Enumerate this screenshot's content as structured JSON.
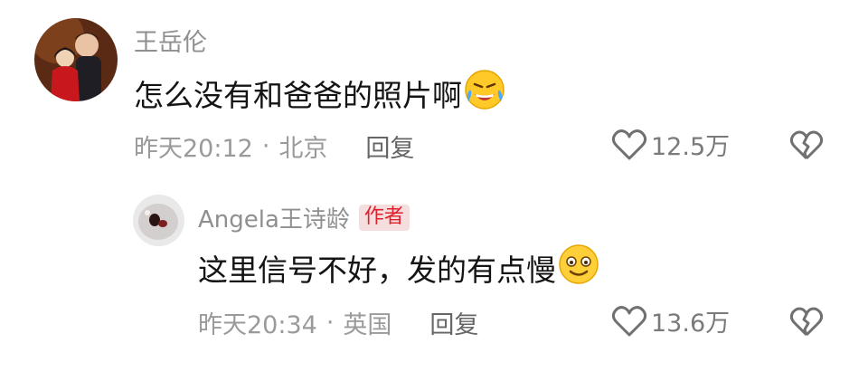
{
  "comments": [
    {
      "username": "王岳伦",
      "text": "怎么没有和爸爸的照片啊",
      "emoji": "laughing-with-tears-emoji",
      "time": "昨天20:12",
      "separator": "·",
      "location": "北京",
      "reply_label": "回复",
      "likes": "12.5万"
    },
    {
      "username": "Angela王诗龄",
      "author_badge": "作者",
      "text": "这里信号不好，发的有点慢",
      "emoji": "smiling-emoji",
      "time": "昨天20:34",
      "separator": "·",
      "location": "英国",
      "reply_label": "回复",
      "likes": "13.6万"
    }
  ],
  "colors": {
    "username": "#8f8f8f",
    "meta": "#9a9a9a",
    "author_badge_bg": "#f5dede",
    "author_badge_text": "#e0202c"
  }
}
